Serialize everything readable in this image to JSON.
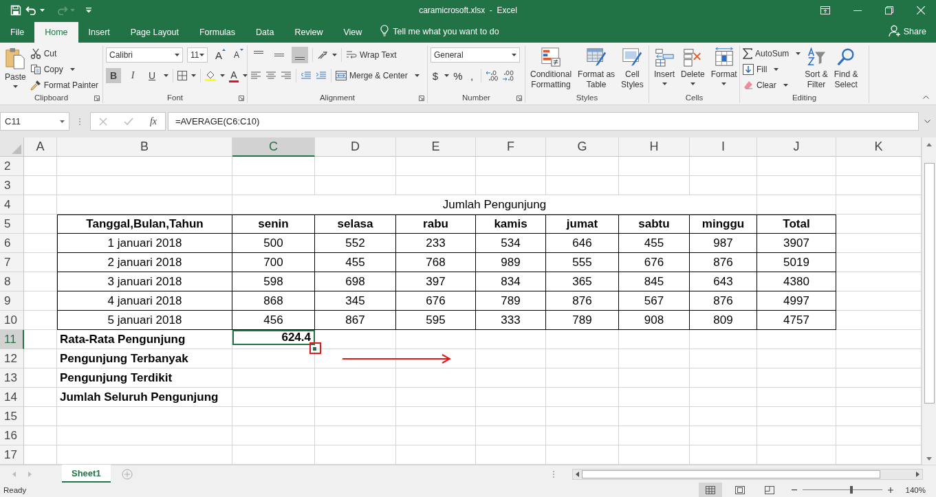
{
  "window": {
    "title": "caramicrosoft.xlsx  -  Excel"
  },
  "tabs": [
    {
      "label": "File",
      "selected": false
    },
    {
      "label": "Home",
      "selected": true
    },
    {
      "label": "Insert",
      "selected": false
    },
    {
      "label": "Page Layout",
      "selected": false
    },
    {
      "label": "Formulas",
      "selected": false
    },
    {
      "label": "Data",
      "selected": false
    },
    {
      "label": "Review",
      "selected": false
    },
    {
      "label": "View",
      "selected": false
    }
  ],
  "tell_me": {
    "placeholder": "Tell me what you want to do"
  },
  "share": "Share",
  "ribbon": {
    "clipboard": {
      "label": "Clipboard",
      "paste": "Paste",
      "cut": "Cut",
      "copy": "Copy",
      "format_painter": "Format Painter"
    },
    "font": {
      "label": "Font",
      "font_name": "Calibri",
      "font_size": "11",
      "grow": "A",
      "shrink": "A",
      "font_color": "A",
      "style_buttons": [
        {
          "text": "B",
          "selected": true
        },
        {
          "text": "I",
          "selected": false
        },
        {
          "text": "U",
          "selected": false
        }
      ]
    },
    "alignment": {
      "label": "Alignment",
      "vertical": [
        {
          "selected": false
        },
        {
          "selected": false
        },
        {
          "selected": true
        }
      ],
      "wrap_text": "Wrap Text",
      "merge_center": "Merge & Center"
    },
    "number": {
      "label": "Number",
      "format": "General",
      "symbols": [
        "$",
        "%",
        ","
      ]
    },
    "styles": {
      "label": "Styles",
      "buttons": [
        "Conditional\nFormatting",
        "Format as\nTable",
        "Cell\nStyles"
      ]
    },
    "cells": {
      "label": "Cells",
      "buttons": [
        "Insert",
        "Delete",
        "Format"
      ]
    },
    "editing": {
      "label": "Editing",
      "autosum": "AutoSum",
      "fill": "Fill",
      "clear": "Clear",
      "sort_filter": "Sort &\nFilter",
      "find_select": "Find &\nSelect"
    }
  },
  "formula_bar": {
    "name_box": "C11",
    "function_label": "fx",
    "formula": "=AVERAGE(C6:C10)"
  },
  "sheet": {
    "columns": [
      {
        "label": "A",
        "selected": false
      },
      {
        "label": "B",
        "selected": false
      },
      {
        "label": "C",
        "selected": true
      },
      {
        "label": "D",
        "selected": false
      },
      {
        "label": "E",
        "selected": false
      },
      {
        "label": "F",
        "selected": false
      },
      {
        "label": "G",
        "selected": false
      },
      {
        "label": "H",
        "selected": false
      },
      {
        "label": "I",
        "selected": false
      },
      {
        "label": "J",
        "selected": false
      },
      {
        "label": "K",
        "selected": false
      }
    ],
    "row_numbers": [
      {
        "label": "2",
        "selected": false
      },
      {
        "label": "3",
        "selected": false
      },
      {
        "label": "4",
        "selected": false
      },
      {
        "label": "5",
        "selected": false
      },
      {
        "label": "6",
        "selected": false
      },
      {
        "label": "7",
        "selected": false
      },
      {
        "label": "8",
        "selected": false
      },
      {
        "label": "9",
        "selected": false
      },
      {
        "label": "10",
        "selected": false
      },
      {
        "label": "11",
        "selected": true
      },
      {
        "label": "12",
        "selected": false
      },
      {
        "label": "13",
        "selected": false
      },
      {
        "label": "14",
        "selected": false
      },
      {
        "label": "15",
        "selected": false
      },
      {
        "label": "16",
        "selected": false
      },
      {
        "label": "17",
        "selected": false
      }
    ],
    "title": "Jumlah Pengunjung",
    "table": {
      "columns": [
        "Tanggal,Bulan,Tahun",
        "senin",
        "selasa",
        "rabu",
        "kamis",
        "jumat",
        "sabtu",
        "minggu",
        "Total"
      ],
      "rows": [
        [
          "1 januari 2018",
          "500",
          "552",
          "233",
          "534",
          "646",
          "455",
          "987",
          "3907"
        ],
        [
          "2 januari 2018",
          "700",
          "455",
          "768",
          "989",
          "555",
          "676",
          "876",
          "5019"
        ],
        [
          "3 januari 2018",
          "598",
          "698",
          "397",
          "834",
          "365",
          "845",
          "643",
          "4380"
        ],
        [
          "4 januari 2018",
          "868",
          "345",
          "676",
          "789",
          "876",
          "567",
          "876",
          "4997"
        ],
        [
          "5 januari 2018",
          "456",
          "867",
          "595",
          "333",
          "789",
          "908",
          "809",
          "4757"
        ]
      ]
    },
    "summary": [
      {
        "label": "Rata-Rata Pengunjung",
        "value": "624.4",
        "selected": true
      },
      {
        "label": "Pengunjung Terbanyak",
        "selected": false
      },
      {
        "label": "Pengunjung Terdikit",
        "selected": false
      },
      {
        "label": "Jumlah Seluruh Pengunjung",
        "selected": false
      }
    ]
  },
  "annotations": {
    "highlight_box": true,
    "arrow": true
  },
  "sheet_tabs": [
    {
      "label": "Sheet1",
      "selected": true
    }
  ],
  "status_bar": {
    "status": "Ready",
    "views": [
      {
        "selected": true
      },
      {
        "selected": false
      },
      {
        "selected": false
      }
    ],
    "zoom": {
      "level": 0.62,
      "reading": "140%"
    }
  }
}
